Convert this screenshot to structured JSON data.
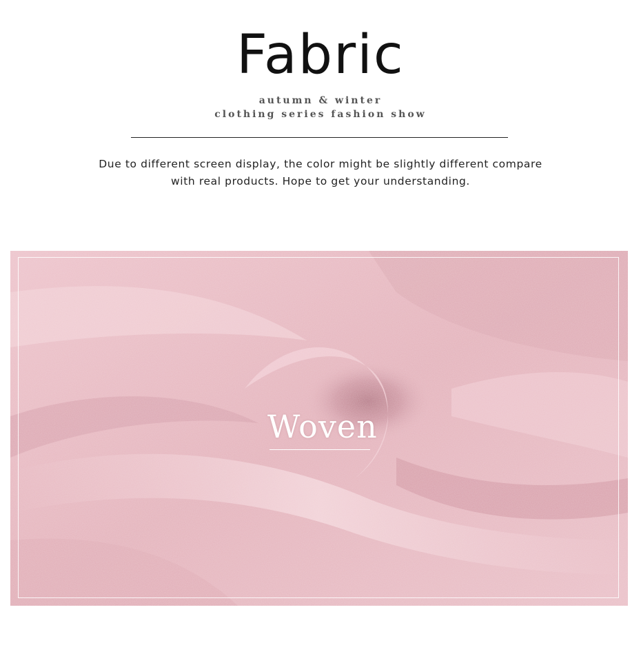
{
  "header": {
    "title": "Fabric",
    "subtitle_line1": "autumn & winter",
    "subtitle_line2": "clothing series fashion show"
  },
  "notice": {
    "line1": "Due to different screen display, the color might be slightly different compare",
    "line2": "with real products.  Hope to get your understanding."
  },
  "photo": {
    "label": "Woven",
    "fabric_color": "#e6b6bf",
    "highlight_color": "#f3d2d8",
    "shadow_color": "#c98b98"
  }
}
